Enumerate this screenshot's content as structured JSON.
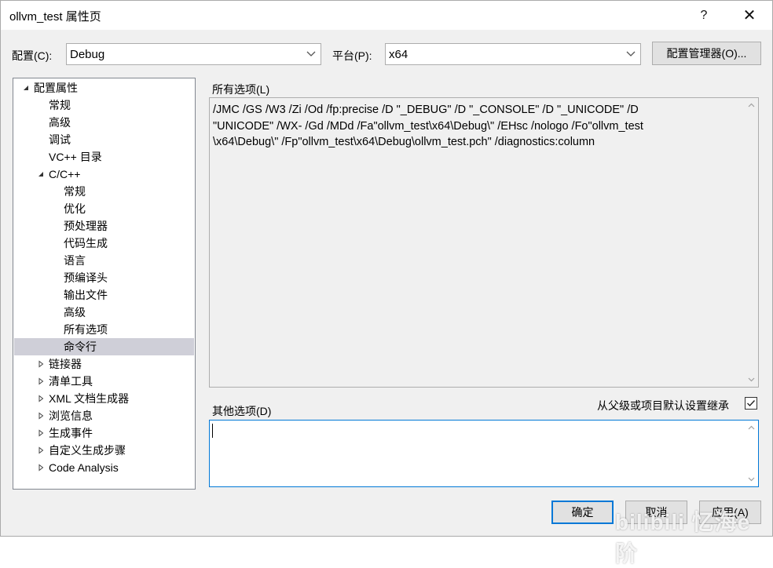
{
  "window": {
    "title": "ollvm_test 属性页",
    "help": "?",
    "close": "✕"
  },
  "config": {
    "config_label": "配置(C):",
    "config_value": "Debug",
    "platform_label": "平台(P):",
    "platform_value": "x64",
    "manager_button": "配置管理器(O)..."
  },
  "tree": {
    "items": [
      {
        "label": "配置属性",
        "level": 0,
        "toggle": "expanded"
      },
      {
        "label": "常规",
        "level": 1,
        "toggle": "none"
      },
      {
        "label": "高级",
        "level": 1,
        "toggle": "none"
      },
      {
        "label": "调试",
        "level": 1,
        "toggle": "none"
      },
      {
        "label": "VC++ 目录",
        "level": 1,
        "toggle": "none"
      },
      {
        "label": "C/C++",
        "level": 1,
        "toggle": "expanded"
      },
      {
        "label": "常规",
        "level": 2,
        "toggle": "none"
      },
      {
        "label": "优化",
        "level": 2,
        "toggle": "none"
      },
      {
        "label": "预处理器",
        "level": 2,
        "toggle": "none"
      },
      {
        "label": "代码生成",
        "level": 2,
        "toggle": "none"
      },
      {
        "label": "语言",
        "level": 2,
        "toggle": "none"
      },
      {
        "label": "预编译头",
        "level": 2,
        "toggle": "none"
      },
      {
        "label": "输出文件",
        "level": 2,
        "toggle": "none"
      },
      {
        "label": "高级",
        "level": 2,
        "toggle": "none"
      },
      {
        "label": "所有选项",
        "level": 2,
        "toggle": "none"
      },
      {
        "label": "命令行",
        "level": 2,
        "toggle": "none",
        "selected": true
      },
      {
        "label": "链接器",
        "level": 1,
        "toggle": "collapsed"
      },
      {
        "label": "清单工具",
        "level": 1,
        "toggle": "collapsed"
      },
      {
        "label": "XML 文档生成器",
        "level": 1,
        "toggle": "collapsed"
      },
      {
        "label": "浏览信息",
        "level": 1,
        "toggle": "collapsed"
      },
      {
        "label": "生成事件",
        "level": 1,
        "toggle": "collapsed"
      },
      {
        "label": "自定义生成步骤",
        "level": 1,
        "toggle": "collapsed"
      },
      {
        "label": "Code Analysis",
        "level": 1,
        "toggle": "collapsed"
      }
    ]
  },
  "all_options": {
    "label": "所有选项(L)",
    "text": "/JMC /GS /W3 /Zi /Od /fp:precise /D \"_DEBUG\" /D \"_CONSOLE\" /D \"_UNICODE\" /D\n\"UNICODE\" /WX- /Gd /MDd /Fa\"ollvm_test\\x64\\Debug\\\" /EHsc /nologo /Fo\"ollvm_test\n\\x64\\Debug\\\" /Fp\"ollvm_test\\x64\\Debug\\ollvm_test.pch\" /diagnostics:column"
  },
  "other_options": {
    "label": "其他选项(D)",
    "inherit_label": "从父级或项目默认设置继承",
    "inherit_checked": true,
    "value": ""
  },
  "buttons": {
    "ok": "确定",
    "cancel": "取消",
    "apply": "应用(A)"
  },
  "watermark": "bilibili 忆海e阶"
}
